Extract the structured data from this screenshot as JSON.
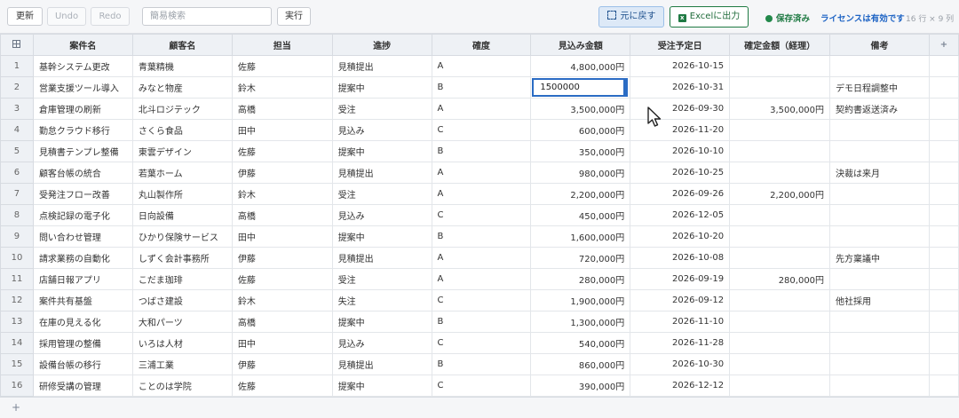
{
  "toolbar": {
    "refresh": "更新",
    "undo": "Undo",
    "redo": "Redo",
    "search_placeholder": "簡易検索",
    "run": "実行",
    "restore": "元に戻す",
    "excel": "Excelに出力",
    "excel_icon": "x",
    "saved": "保存済み",
    "license": "ライセンスは有効です",
    "dims": "16 行 × 9 列"
  },
  "grid": {
    "menu_icon": "grid-icon",
    "add_col": "+",
    "add_row": "+",
    "columns": [
      "案件名",
      "顧客名",
      "担当",
      "進捗",
      "確度",
      "見込み金額",
      "受注予定日",
      "確定金額（経理）",
      "備考"
    ],
    "editing_value": "1500000",
    "rows": [
      {
        "n": "1",
        "c": [
          "基幹システム更改",
          "青葉精機",
          "佐藤",
          "見積提出",
          "A",
          "4,800,000円",
          "2026-10-15",
          "",
          ""
        ]
      },
      {
        "n": "2",
        "c": [
          "営業支援ツール導入",
          "みなと物産",
          "鈴木",
          "提案中",
          "B",
          "",
          "2026-10-31",
          "",
          "デモ日程調整中"
        ]
      },
      {
        "n": "3",
        "c": [
          "倉庫管理の刷新",
          "北斗ロジテック",
          "高橋",
          "受注",
          "A",
          "3,500,000円",
          "2026-09-30",
          "3,500,000円",
          "契約書返送済み"
        ]
      },
      {
        "n": "4",
        "c": [
          "勤怠クラウド移行",
          "さくら食品",
          "田中",
          "見込み",
          "C",
          "600,000円",
          "2026-11-20",
          "",
          ""
        ]
      },
      {
        "n": "5",
        "c": [
          "見積書テンプレ整備",
          "東雲デザイン",
          "佐藤",
          "提案中",
          "B",
          "350,000円",
          "2026-10-10",
          "",
          ""
        ]
      },
      {
        "n": "6",
        "c": [
          "顧客台帳の統合",
          "若葉ホーム",
          "伊藤",
          "見積提出",
          "A",
          "980,000円",
          "2026-10-25",
          "",
          "決裁は来月"
        ]
      },
      {
        "n": "7",
        "c": [
          "受発注フロー改善",
          "丸山製作所",
          "鈴木",
          "受注",
          "A",
          "2,200,000円",
          "2026-09-26",
          "2,200,000円",
          ""
        ]
      },
      {
        "n": "8",
        "c": [
          "点検記録の電子化",
          "日向設備",
          "高橋",
          "見込み",
          "C",
          "450,000円",
          "2026-12-05",
          "",
          ""
        ]
      },
      {
        "n": "9",
        "c": [
          "問い合わせ管理",
          "ひかり保険サービス",
          "田中",
          "提案中",
          "B",
          "1,600,000円",
          "2026-10-20",
          "",
          ""
        ]
      },
      {
        "n": "10",
        "c": [
          "請求業務の自動化",
          "しずく会計事務所",
          "伊藤",
          "見積提出",
          "A",
          "720,000円",
          "2026-10-08",
          "",
          "先方稟議中"
        ]
      },
      {
        "n": "11",
        "c": [
          "店舗日報アプリ",
          "こだま珈琲",
          "佐藤",
          "受注",
          "A",
          "280,000円",
          "2026-09-19",
          "280,000円",
          ""
        ]
      },
      {
        "n": "12",
        "c": [
          "案件共有基盤",
          "つばさ建設",
          "鈴木",
          "失注",
          "C",
          "1,900,000円",
          "2026-09-12",
          "",
          "他社採用"
        ]
      },
      {
        "n": "13",
        "c": [
          "在庫の見える化",
          "大和パーツ",
          "高橋",
          "提案中",
          "B",
          "1,300,000円",
          "2026-11-10",
          "",
          ""
        ]
      },
      {
        "n": "14",
        "c": [
          "採用管理の整備",
          "いろは人材",
          "田中",
          "見込み",
          "C",
          "540,000円",
          "2026-11-28",
          "",
          ""
        ]
      },
      {
        "n": "15",
        "c": [
          "設備台帳の移行",
          "三浦工業",
          "伊藤",
          "見積提出",
          "B",
          "860,000円",
          "2026-10-30",
          "",
          ""
        ]
      },
      {
        "n": "16",
        "c": [
          "研修受講の管理",
          "ことのは学院",
          "佐藤",
          "提案中",
          "C",
          "390,000円",
          "2026-12-12",
          "",
          ""
        ]
      }
    ]
  }
}
